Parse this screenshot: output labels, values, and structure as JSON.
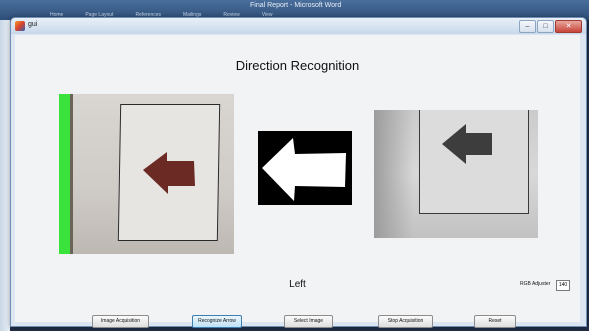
{
  "background_window": {
    "title": "Final Report - Microsoft Word",
    "tabs": [
      "Home",
      "Page Layout",
      "References",
      "Mailings",
      "Review",
      "View"
    ]
  },
  "window": {
    "title": "gui",
    "controls": {
      "minimize": "–",
      "maximize": "□",
      "close": "✕"
    }
  },
  "main": {
    "heading": "Direction Recognition",
    "result_text": "Left",
    "images": {
      "camera_left_icon": "arrow-left-photo",
      "binary_icon": "arrow-left-binary",
      "camera_right_icon": "arrow-left-grayscale"
    }
  },
  "buttons": {
    "image_acquisition": "Image Acquisition",
    "recognize_arrow": "Recognize Arrow",
    "select_image": "Select Image",
    "stop_acquisition": "Stop Acquisition",
    "reset": "Reset"
  },
  "rgb_adjuster": {
    "label": "RGB Adjuster",
    "value": "140"
  },
  "colors": {
    "green_marker": "#39e33c",
    "arrow_red": "#6b2a23",
    "focus_blue": "#3c7fb1"
  }
}
